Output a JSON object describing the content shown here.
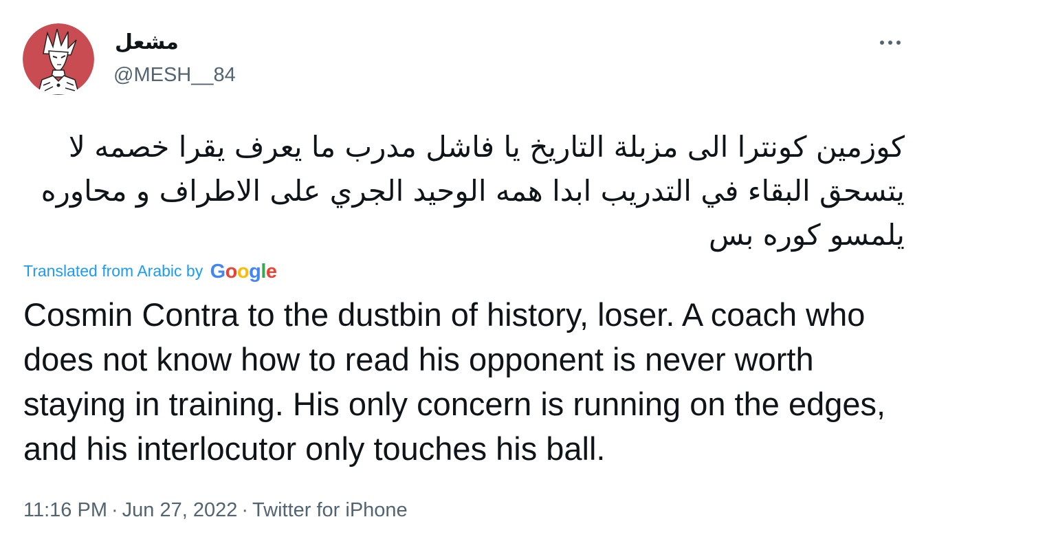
{
  "author": {
    "display_name": "مشعل",
    "handle": "@MESH__84",
    "avatar_icon": "anime-character-avatar",
    "avatar_bg": "#c94c52"
  },
  "more_icon": "ellipsis-icon",
  "tweet": {
    "original_text": "كوزمين كونترا الى مزبلة التاريخ يا فاشل مدرب ما يعرف يقرا خصمه لا يتسحق البقاء في التدريب ابدا همه الوحيد الجري على الاطراف و محاوره يلمسو كوره بس",
    "translation_prefix": "Translated from Arabic by",
    "translation_provider": "Google",
    "translated_text": "Cosmin Contra to the dustbin of history, loser. A coach who does not know how to read his opponent is never worth staying in training. His only concern is running on the edges, and his interlocutor only touches his ball."
  },
  "meta": {
    "time": "11:16 PM",
    "separator": "·",
    "date": "Jun 27, 2022",
    "source": "Twitter for iPhone"
  },
  "colors": {
    "link_blue": "#1d9bf0",
    "secondary_text": "#536471",
    "primary_text": "#0f1419"
  }
}
